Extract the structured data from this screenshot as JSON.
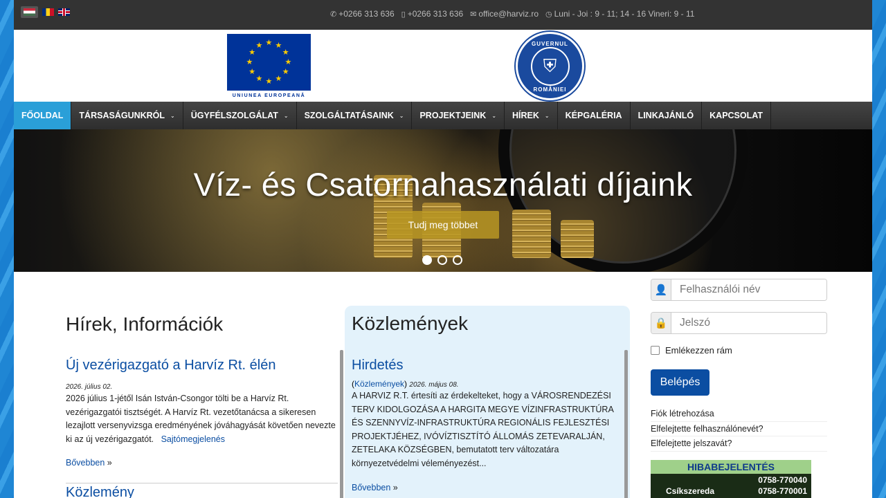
{
  "topbar": {
    "languages": [
      "Magyar",
      "Română",
      "English"
    ],
    "phone1": "+0266 313 636",
    "phone2": "+0266 313 636",
    "email": "office@harviz.ro",
    "hours": "Luni - Joi : 9 - 11; 14 - 16 Vineri: 9 - 11"
  },
  "logos": {
    "eu_caption": "UNIUNEA EUROPEANĂ",
    "gov_top": "GUVERNUL",
    "gov_bottom": "ROMÂNIEI"
  },
  "nav": {
    "items": [
      {
        "label": "FŐOLDAL",
        "dropdown": false
      },
      {
        "label": "TÁRSASÁGUNKRÓL",
        "dropdown": true
      },
      {
        "label": "ÜGYFÉLSZOLGÁLAT",
        "dropdown": true
      },
      {
        "label": "SZOLGÁLTATÁSAINK",
        "dropdown": true
      },
      {
        "label": "PROJEKTJEINK",
        "dropdown": true
      },
      {
        "label": "HÍREK",
        "dropdown": true
      },
      {
        "label": "KÉPGALÉRIA",
        "dropdown": false
      },
      {
        "label": "LINKAJÁNLÓ",
        "dropdown": false
      },
      {
        "label": "KAPCSOLAT",
        "dropdown": false
      }
    ],
    "active_index": 0
  },
  "hero": {
    "title": "Víz- és Csatornahasználati díjaink",
    "button": "Tudj meg többet",
    "slide_count": 3,
    "active_slide": 1
  },
  "news": {
    "heading": "Hírek, Információk",
    "article_title": "Új vezérigazgató a Harvíz Rt. élén",
    "date": "2026. július 02.",
    "body": "2026 július 1-jétől Isán István-Csongor tölti be a Harvíz Rt. vezérigazgatói tisztségét. A Harvíz Rt. vezetőtanácsa a sikeresen lezajlott versenyvizsga eredményének jóváhagyását követően nevezte ki az új vezérigazgatót.",
    "tag": "Sajtómegjelenés",
    "more": "Bővebben",
    "more_suffix": "»",
    "next_title": "Közlemény"
  },
  "notices": {
    "heading": "Közlemények",
    "article_title": "Hirdetés",
    "category": "Közlemények",
    "date": "2026. május 08.",
    "body": "A HARVIZ R.T. értesíti az érdekelteket, hogy a VÁROSRENDEZÉSI TERV KIDOLGOZÁSA A HARGITA MEGYE VÍZINFRASTRUKTÚRA ÉS SZENNYVÍZ-INFRASTRUKTÚRA REGIONÁLIS FEJLESZTÉSI PROJEKTJÉHEZ, IVÓVÍZTISZTÍTÓ ÁLLOMÁS ZETEVARALJÁN, ZETELAKA KÖZSÉGBEN, bemutatott terv változatára környezetvédelmi véleményezést...",
    "more": "Bővebben",
    "more_suffix": "»"
  },
  "login": {
    "username_placeholder": "Felhasználói név",
    "password_placeholder": "Jelszó",
    "remember": "Emlékezzen rám",
    "submit": "Belépés",
    "links": [
      "Fiók létrehozása",
      "Elfelejtette felhasználónevét?",
      "Elfelejtette jelszavát?"
    ]
  },
  "banner": {
    "title": "HIBABEJELENTÉS",
    "phone_a": "0758-770040",
    "city": "Csíkszereda",
    "phone_b": "0758-770001"
  },
  "colors": {
    "accent": "#2a9fd8",
    "link": "#0b4ea2",
    "notice_bg": "#e3f2fb"
  }
}
